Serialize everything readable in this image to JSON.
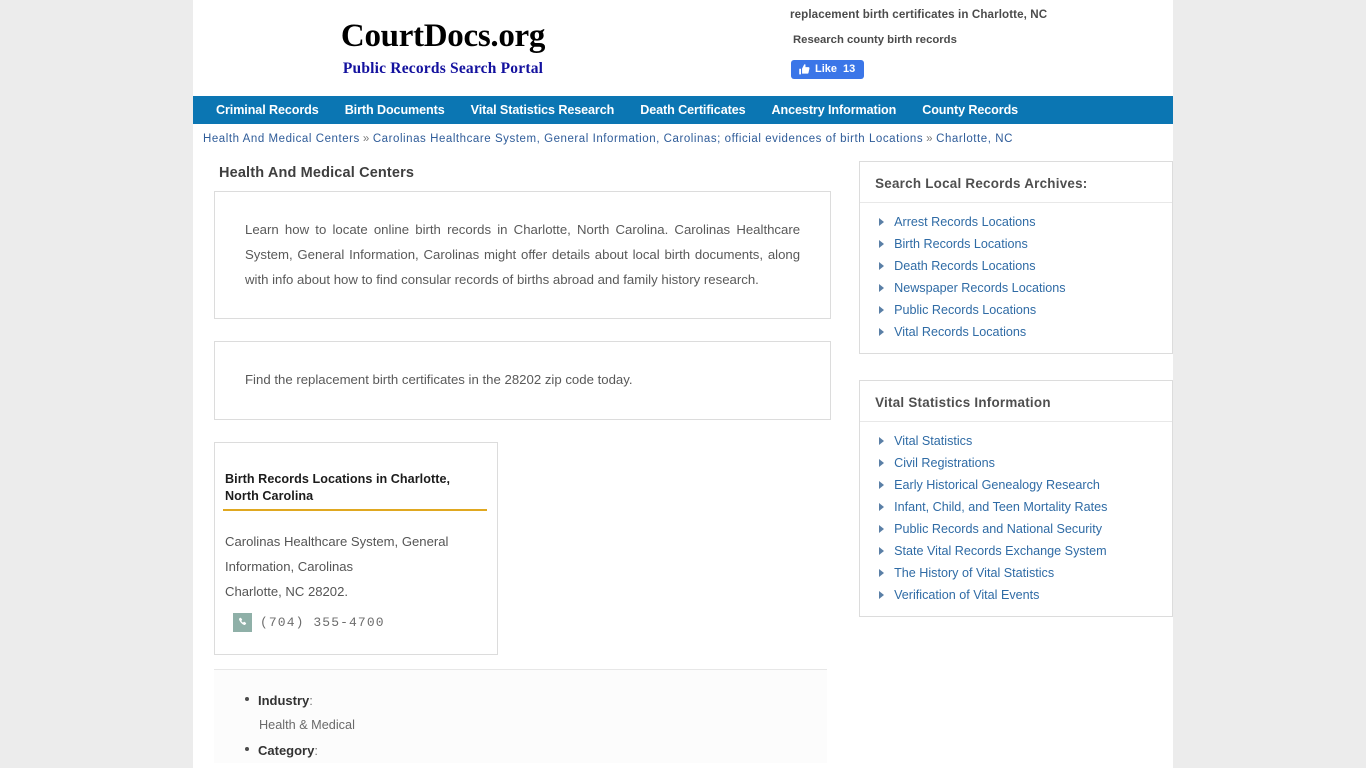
{
  "header": {
    "brand_title": "CourtDocs.org",
    "brand_subtitle": "Public Records Search Portal",
    "tagline_primary": "replacement birth certificates in Charlotte, NC",
    "tagline_secondary": "Research county birth records",
    "facebook": {
      "icon": "thumbs-up-icon",
      "label": "Like",
      "count": "13"
    }
  },
  "nav": {
    "items": [
      {
        "label": "Criminal Records"
      },
      {
        "label": "Birth Documents"
      },
      {
        "label": "Vital Statistics Research"
      },
      {
        "label": "Death Certificates"
      },
      {
        "label": "Ancestry Information"
      },
      {
        "label": "County Records"
      }
    ]
  },
  "breadcrumb": {
    "separator": "»",
    "items": [
      {
        "label": "Health And Medical Centers"
      },
      {
        "label": "Carolinas Healthcare System, General Information, Carolinas; official evidences of birth Locations"
      },
      {
        "label": "Charlotte, NC"
      }
    ]
  },
  "main": {
    "page_title": "Health And Medical Centers",
    "intro_paragraph": "Learn how to locate online birth records in Charlotte, North Carolina. Carolinas Healthcare System, General Information, Carolinas might offer details about local birth documents, along with info about how to find consular records of births abroad and family history research.",
    "zip_paragraph": "Find the replacement birth certificates in the 28202 zip code today.",
    "address_card": {
      "title": "Birth Records Locations in Charlotte, North Carolina",
      "line_1": "Carolinas Healthcare System, General",
      "line_2": "Information, Carolinas",
      "line_3": "Charlotte, NC 28202.",
      "phone_icon": "phone-icon",
      "phone": "(704) 355-4700"
    },
    "details": [
      {
        "label": "Industry",
        "colon": ":",
        "value": "Health & Medical"
      },
      {
        "label": "Category",
        "colon": ":",
        "value": ""
      }
    ]
  },
  "sidebar": {
    "boxes": [
      {
        "heading": "Search Local Records Archives:",
        "links": [
          {
            "label": "Arrest Records Locations"
          },
          {
            "label": "Birth Records Locations"
          },
          {
            "label": "Death Records Locations"
          },
          {
            "label": "Newspaper Records Locations"
          },
          {
            "label": "Public Records Locations"
          },
          {
            "label": "Vital Records Locations"
          }
        ]
      },
      {
        "heading": "Vital Statistics Information",
        "links": [
          {
            "label": "Vital Statistics"
          },
          {
            "label": "Civil Registrations"
          },
          {
            "label": "Early Historical Genealogy Research"
          },
          {
            "label": "Infant, Child, and Teen Mortality Rates"
          },
          {
            "label": "Public Records and National Security"
          },
          {
            "label": "State Vital Records Exchange System"
          },
          {
            "label": "The History of Vital Statistics"
          },
          {
            "label": "Verification of Vital Events"
          }
        ]
      }
    ]
  },
  "colors": {
    "nav_blue": "#0b76b3",
    "link_blue": "#2f6ba5",
    "brand_sub_blue": "#13119e",
    "gold_rule": "#e0a820",
    "facebook_blue": "#3b76e8",
    "phone_icon_bg": "#8fb0a8"
  }
}
